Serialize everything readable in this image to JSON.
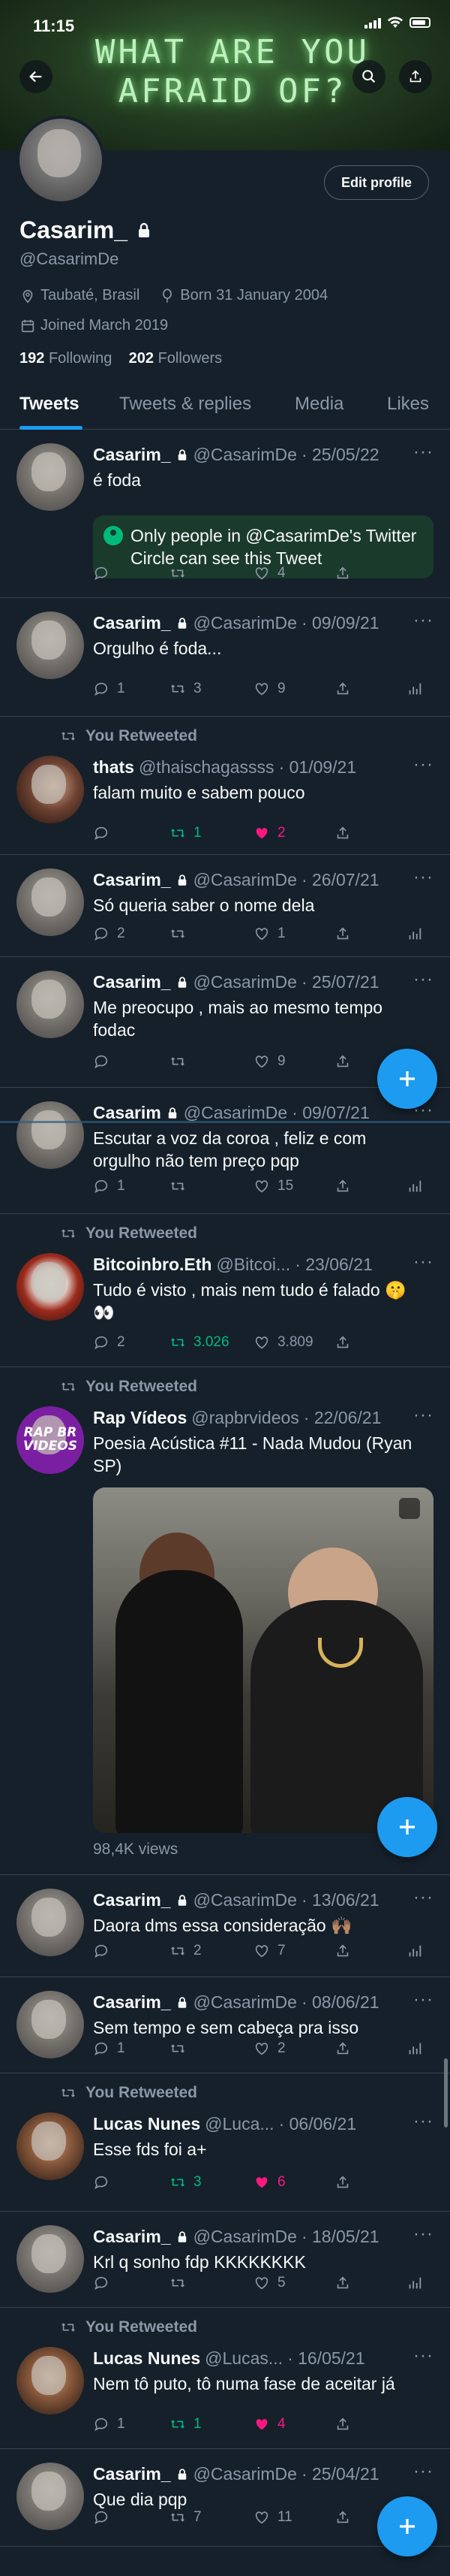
{
  "status_bar": {
    "time": "11:15"
  },
  "banner": {
    "text": "WHAT ARE YOU\nAFRAID OF?"
  },
  "profile": {
    "edit_label": "Edit profile",
    "name": "Casarim_",
    "handle": "@CasarimDe",
    "location": "Taubaté, Brasil",
    "born": "Born 31 January 2004",
    "joined": "Joined March 2019",
    "following_count": "192",
    "following_label": "Following",
    "followers_count": "202",
    "followers_label": "Followers"
  },
  "tabs": [
    "Tweets",
    "Tweets & replies",
    "Media",
    "Likes"
  ],
  "you_retweeted": "You Retweeted",
  "circle_notice": "Only people in @CasarimDe's Twitter Circle can see this Tweet",
  "tweets": [
    {
      "name": "Casarim_",
      "handle": "@CasarimDe",
      "date": "· 25/05/22",
      "text": "é foda",
      "reply": "",
      "retweets": "",
      "likes": "4"
    },
    {
      "name": "Casarim_",
      "handle": "@CasarimDe",
      "date": "· 09/09/21",
      "text": "Orgulho é foda...",
      "reply": "1",
      "retweets": "3",
      "likes": "9"
    },
    {
      "name": "thats",
      "handle": "@thaischagassss",
      "date": "· 01/09/21",
      "text": "falam muito e sabem pouco",
      "reply": "",
      "retweets": "1",
      "likes": "2"
    },
    {
      "name": "Casarim_",
      "handle": "@CasarimDe",
      "date": "· 26/07/21",
      "text": "Só queria saber o nome dela",
      "reply": "2",
      "retweets": "",
      "likes": "1"
    },
    {
      "name": "Casarim_",
      "handle": "@CasarimDe",
      "date": "· 25/07/21",
      "text": "Me preocupo , mais ao mesmo tempo fodac",
      "reply": "",
      "retweets": "",
      "likes": "9"
    },
    {
      "name": "Casarim",
      "handle": "@CasarimDe",
      "date": "· 09/07/21",
      "text": "Escutar a voz da coroa , feliz e com orgulho não tem preço pqp",
      "reply": "1",
      "retweets": "",
      "likes": "15"
    },
    {
      "name": "Bitcoinbro.Eth",
      "handle": "@Bitcoi...",
      "date": "· 23/06/21",
      "text": "Tudo é visto , mais nem tudo é falado 🤫👀",
      "reply": "2",
      "retweets": "3.026",
      "likes": "3.809"
    },
    {
      "name": "Rap Vídeos",
      "handle": "@rapbrvideos",
      "date": "· 22/06/21",
      "text": "Poesia Acústica #11 - Nada Mudou (Ryan SP)",
      "views": "98,4K views",
      "avatar_text": "RAP BR VIDEOS"
    },
    {
      "name": "Casarim_",
      "handle": "@CasarimDe",
      "date": "· 13/06/21",
      "text": "Daora dms essa consideração 🙌🏽",
      "reply": "",
      "retweets": "2",
      "likes": "7"
    },
    {
      "name": "Casarim_",
      "handle": "@CasarimDe",
      "date": "· 08/06/21",
      "text": "Sem tempo e sem cabeça pra isso",
      "reply": "1",
      "retweets": "",
      "likes": "2"
    },
    {
      "name": "Lucas Nunes",
      "handle": "@Luca...",
      "date": "· 06/06/21",
      "text": "Esse fds foi a+",
      "reply": "",
      "retweets": "3",
      "likes": "6"
    },
    {
      "name": "Casarim_",
      "handle": "@CasarimDe",
      "date": "· 18/05/21",
      "text": "Krl q sonho fdp KKKKKKKK",
      "reply": "",
      "retweets": "",
      "likes": "5"
    },
    {
      "name": "Lucas Nunes",
      "handle": "@Lucas...",
      "date": "· 16/05/21",
      "text": "Nem tô puto, tô numa fase de aceitar já",
      "reply": "1",
      "retweets": "1",
      "likes": "4"
    },
    {
      "name": "Casarim_",
      "handle": "@CasarimDe",
      "date": "· 25/04/21",
      "text": "Que dia pqp",
      "reply": "",
      "retweets": "7",
      "likes": "11"
    }
  ],
  "colors": {
    "background": "#15202b",
    "accent": "#1d9bf0",
    "retweet_green": "#00ba7c",
    "like_pink": "#f91880",
    "muted": "#8b98a5",
    "divider": "#38444d"
  },
  "icons": [
    "back-arrow-icon",
    "search-icon",
    "share-icon",
    "lock-icon",
    "location-icon",
    "balloon-icon",
    "calendar-icon",
    "reply-icon",
    "retweet-icon",
    "heart-icon",
    "share-icon",
    "analytics-icon",
    "compose-plus-icon"
  ]
}
